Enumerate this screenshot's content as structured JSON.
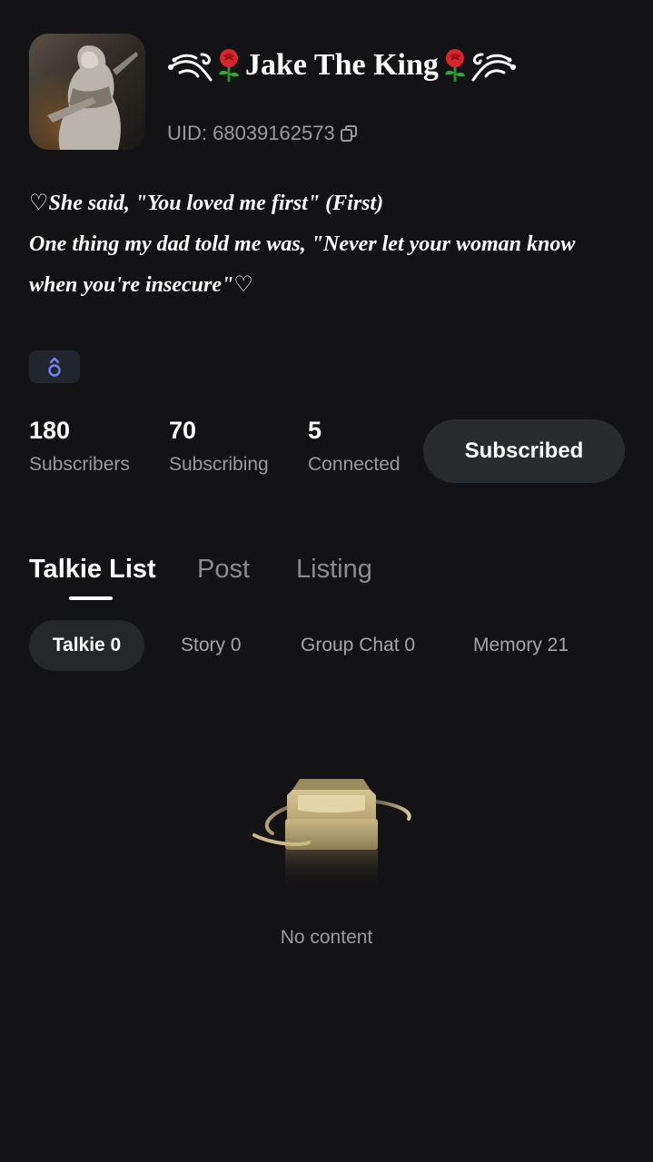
{
  "profile": {
    "avatar_icon": "knight-portrait-avatar",
    "name_prefix_icon": "swirl-ornament-icon",
    "rose_icon": "rose-emoji-icon",
    "name": "Jake The King",
    "name_suffix_icon": "swirl-ornament-icon",
    "uid": "UID: 68039162573",
    "copy_icon": "copy-icon",
    "bio_lines": [
      "♡She said, \"You loved me first\" (First)",
      "One thing my dad told me was, \"Never let your woman know",
      "when you're insecure\"♡"
    ],
    "badge_icon": "gender-badge-icon"
  },
  "stats": [
    {
      "value": "180",
      "label": "Subscribers"
    },
    {
      "value": "70",
      "label": "Subscribing"
    },
    {
      "value": "5",
      "label": "Connected"
    }
  ],
  "subscribe_button": "Subscribed",
  "tabs": [
    {
      "label": "Talkie List",
      "active": true
    },
    {
      "label": "Post",
      "active": false
    },
    {
      "label": "Listing",
      "active": false
    }
  ],
  "chips": [
    {
      "label": "Talkie 0",
      "active": true
    },
    {
      "label": "Story 0",
      "active": false
    },
    {
      "label": "Group Chat 0",
      "active": false
    },
    {
      "label": "Memory 21",
      "active": false
    }
  ],
  "empty_state": {
    "icon": "empty-tray-icon",
    "text": "No content"
  },
  "colors": {
    "background": "#131315",
    "button_bg": "#2a2b2f",
    "muted_text": "#9a9ba0",
    "badge_accent": "#6f86ff",
    "illustration_gold": "#cbb986"
  }
}
